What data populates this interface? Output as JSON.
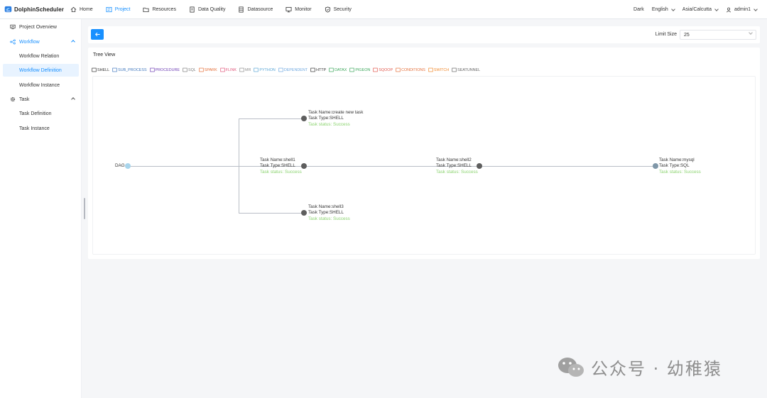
{
  "app": {
    "name": "DolphinScheduler"
  },
  "nav": {
    "home": "Home",
    "project": "Project",
    "resources": "Resources",
    "data_quality": "Data Quality",
    "datasource": "Datasource",
    "monitor": "Monitor",
    "security": "Security"
  },
  "header_right": {
    "theme": "Dark",
    "language": "English",
    "timezone": "Asia/Calcutta",
    "user": "admin1"
  },
  "sidebar": {
    "project_overview": "Project Overview",
    "workflow": "Workflow",
    "workflow_relation": "Workflow Relation",
    "workflow_definition": "Workflow Definition",
    "workflow_instance": "Workflow Instance",
    "task": "Task",
    "task_definition": "Task Definition",
    "task_instance": "Task Instance"
  },
  "toolbar": {
    "limit_label": "Limit Size",
    "limit_value": "25"
  },
  "tree": {
    "title": "Tree View",
    "legend": [
      {
        "label": "SHELL",
        "color": "#333333"
      },
      {
        "label": "SUB_PROCESS",
        "color": "#4178be"
      },
      {
        "label": "PROCEDURE",
        "color": "#6f3fb5"
      },
      {
        "label": "SQL",
        "color": "#7d7d7d"
      },
      {
        "label": "SPARK",
        "color": "#e46f3a"
      },
      {
        "label": "FLINK",
        "color": "#e0567b"
      },
      {
        "label": "MR",
        "color": "#8e8e8e"
      },
      {
        "label": "PYTHON",
        "color": "#5aa6d6"
      },
      {
        "label": "DEPENDENT",
        "color": "#6fa8e0"
      },
      {
        "label": "HTTP",
        "color": "#333333"
      },
      {
        "label": "DATAX",
        "color": "#3aa65a"
      },
      {
        "label": "PIGEON",
        "color": "#3aa65a"
      },
      {
        "label": "SQOOP",
        "color": "#e0564b"
      },
      {
        "label": "CONDITIONS",
        "color": "#e46f3a"
      },
      {
        "label": "SWITCH",
        "color": "#f0882c"
      },
      {
        "label": "SEATUNNEL",
        "color": "#666666"
      }
    ],
    "root": "DAG",
    "nodes": {
      "create_new_task": {
        "name": "Task Name:create new task",
        "type": "Task Type:SHELL",
        "status": "Task status: Success"
      },
      "shell1": {
        "name": "Task Name:shell1",
        "type": "Task Type:SHELL",
        "status": "Task status: Success"
      },
      "shell2": {
        "name": "Task Name:shell2",
        "type": "Task Type:SHELL",
        "status": "Task status: Success"
      },
      "shell3": {
        "name": "Task Name:shell3",
        "type": "Task Type:SHELL",
        "status": "Task status: Success"
      },
      "mysql": {
        "name": "Task Name:mysql",
        "type": "Task Type:SQL",
        "status": "Task status: Success"
      }
    }
  },
  "watermark": {
    "text": "公众号 · 幼稚猿"
  },
  "colors": {
    "accent": "#1890ff",
    "success": "#8bd36f",
    "node_dark": "#5e5e5e",
    "node_sql": "#7f97a8",
    "root_node": "#a8d5ec"
  }
}
